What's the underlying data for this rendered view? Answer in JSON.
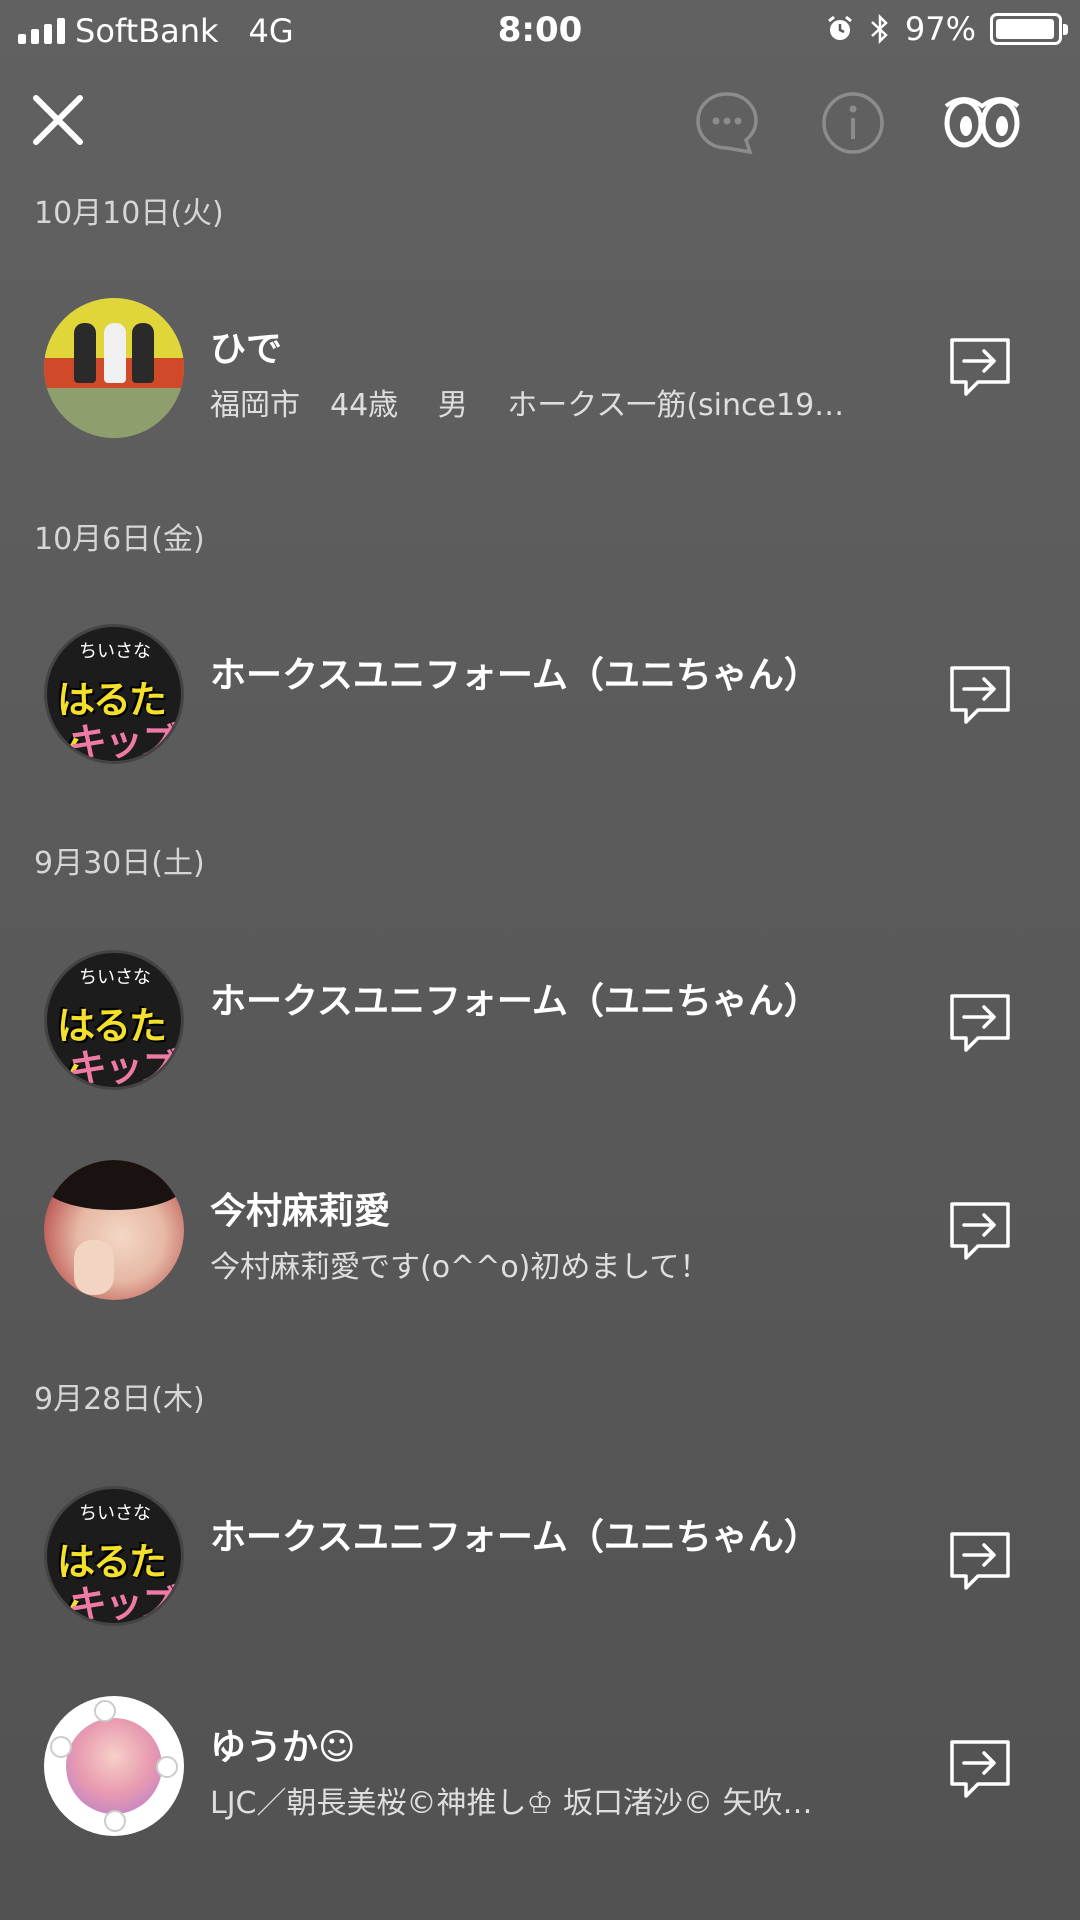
{
  "status_bar": {
    "carrier": "SoftBank",
    "network": "4G",
    "time": "8:00",
    "battery": "97%",
    "battery_level": 0.97,
    "alarm_icon": "alarm-icon",
    "bluetooth_icon": "bluetooth-icon"
  },
  "header": {
    "close_icon": "close-icon",
    "chat_icon": "chat-bubble-icon",
    "info_icon": "info-icon",
    "eyes_icon": "eyes-icon"
  },
  "sections": [
    {
      "date": "10月10日(火)",
      "items": [
        {
          "name": "ひで",
          "subtitle": "福岡市　44歳　 男　 ホークス一筋(since19…",
          "avatar": "stadium-photo"
        }
      ]
    },
    {
      "date": "10月6日(金)",
      "items": [
        {
          "name": "ホークスユニフォーム（ユニちゃん）",
          "subtitle": "",
          "avatar": "haruta-kids-sticker"
        }
      ]
    },
    {
      "date": "9月30日(土)",
      "items": [
        {
          "name": "ホークスユニフォーム（ユニちゃん）",
          "subtitle": "",
          "avatar": "haruta-kids-sticker"
        },
        {
          "name": "今村麻莉愛",
          "subtitle": "今村麻莉愛です(o^^o)初めまして！",
          "avatar": "girl-photo"
        }
      ]
    },
    {
      "date": "9月28日(木)",
      "items": [
        {
          "name": "ホークスユニフォーム（ユニちゃん）",
          "subtitle": "",
          "avatar": "haruta-kids-sticker"
        },
        {
          "name": "ゆうか☺",
          "subtitle": "LJC／朝長美桜©神推し♔ 坂口渚沙© 矢吹…",
          "avatar": "flower-frame-photo"
        }
      ]
    }
  ],
  "avatar_sticker_text": {
    "top": "ちいさな",
    "line1": "はるたん",
    "line2": "キッズ"
  }
}
